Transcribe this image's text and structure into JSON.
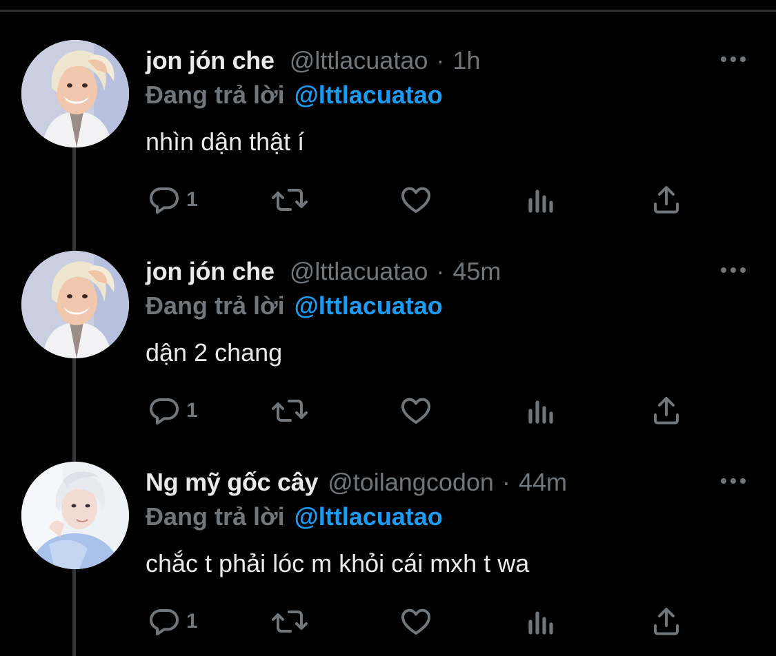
{
  "colors": {
    "background": "#000000",
    "text_primary": "#e7e9ea",
    "text_secondary": "#71767b",
    "link": "#1d9bf0",
    "thread_line": "#333639"
  },
  "tweets": [
    {
      "display_name": "jon jón che",
      "handle": "@lttlacuatao",
      "separator": "·",
      "time": "1h",
      "replying_label": "Đang trả lời",
      "replying_to": "@lttlacuatao",
      "text": "nhìn dận thật í",
      "reply_count": "1",
      "avatar_icon": "avatar-blonde-person"
    },
    {
      "display_name": "jon jón che",
      "handle": "@lttlacuatao",
      "separator": "·",
      "time": "45m",
      "replying_label": "Đang trả lời",
      "replying_to": "@lttlacuatao",
      "text": "dận 2 chang",
      "reply_count": "1",
      "avatar_icon": "avatar-blonde-person"
    },
    {
      "display_name": "Ng mỹ gốc cây",
      "handle": "@toilangcodon",
      "separator": "·",
      "time": "44m",
      "replying_label": "Đang trả lời",
      "replying_to": "@lttlacuatao",
      "text": "chắc t phải lóc m khỏi cái mxh t wa",
      "reply_count": "1",
      "avatar_icon": "avatar-silver-hair-person"
    }
  ],
  "action_icons": [
    "reply-icon",
    "retweet-icon",
    "like-icon",
    "analytics-icon",
    "share-icon"
  ]
}
